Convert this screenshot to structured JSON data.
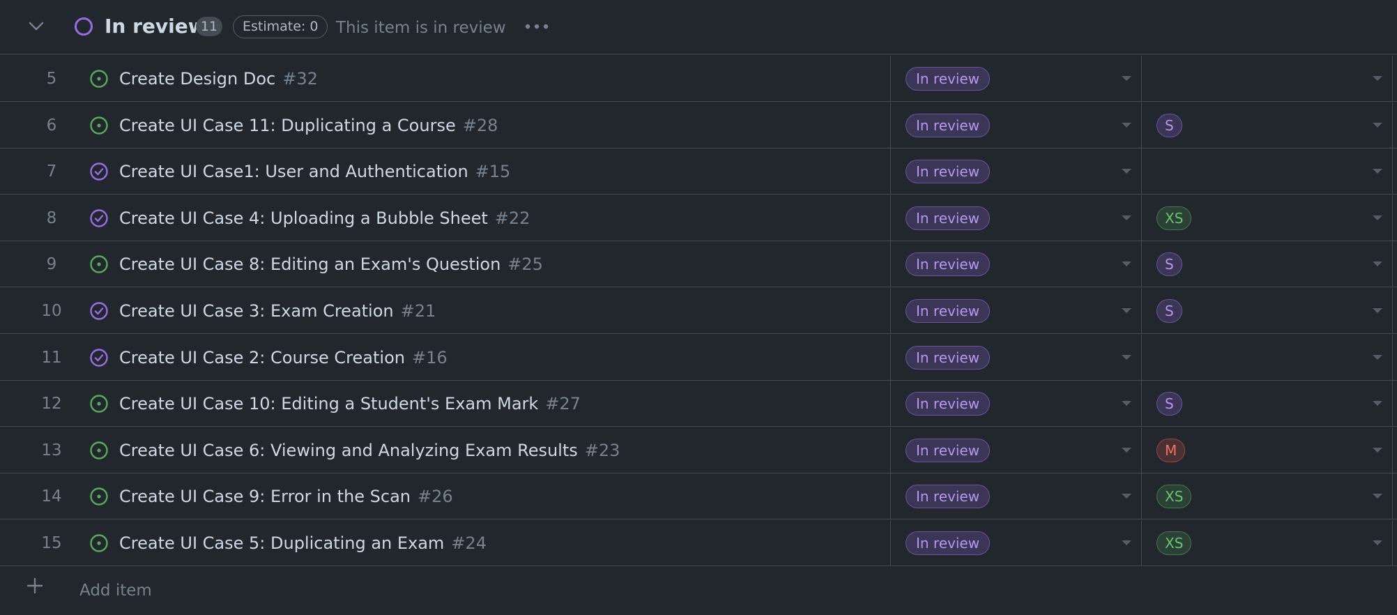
{
  "group": {
    "title": "In review",
    "count": "11",
    "estimate": "Estimate: 0",
    "description": "This item is in review",
    "status_color": "#986ee2"
  },
  "rows": [
    {
      "num": "5",
      "title": "Create Design Doc",
      "issue": "#32",
      "icon": "issue-open-icon",
      "status": "In review",
      "size": ""
    },
    {
      "num": "6",
      "title": "Create UI Case 11: Duplicating a Course",
      "issue": "#28",
      "icon": "issue-open-icon",
      "status": "In review",
      "size": "S"
    },
    {
      "num": "7",
      "title": "Create UI Case1: User and Authentication",
      "issue": "#15",
      "icon": "issue-closed-icon",
      "status": "In review",
      "size": ""
    },
    {
      "num": "8",
      "title": "Create UI Case 4: Uploading a Bubble Sheet",
      "issue": "#22",
      "icon": "issue-closed-icon",
      "status": "In review",
      "size": "XS"
    },
    {
      "num": "9",
      "title": "Create UI Case 8: Editing an Exam's Question",
      "issue": "#25",
      "icon": "issue-open-icon",
      "status": "In review",
      "size": "S"
    },
    {
      "num": "10",
      "title": "Create UI Case 3: Exam Creation",
      "issue": "#21",
      "icon": "issue-closed-icon",
      "status": "In review",
      "size": "S"
    },
    {
      "num": "11",
      "title": "Create UI Case 2: Course Creation",
      "issue": "#16",
      "icon": "issue-closed-icon",
      "status": "In review",
      "size": ""
    },
    {
      "num": "12",
      "title": "Create UI Case 10: Editing a Student's Exam Mark",
      "issue": "#27",
      "icon": "issue-open-icon",
      "status": "In review",
      "size": "S"
    },
    {
      "num": "13",
      "title": "Create UI Case 6: Viewing and Analyzing Exam Results",
      "issue": "#23",
      "icon": "issue-open-icon",
      "status": "In review",
      "size": "M"
    },
    {
      "num": "14",
      "title": "Create UI Case 9: Error in the Scan",
      "issue": "#26",
      "icon": "issue-open-icon",
      "status": "In review",
      "size": "XS"
    },
    {
      "num": "15",
      "title": "Create UI Case 5: Duplicating an Exam",
      "issue": "#24",
      "icon": "issue-open-icon",
      "status": "In review",
      "size": "XS"
    }
  ],
  "add_item": {
    "label": "Add item"
  },
  "colors": {
    "background": "#22272e",
    "open_icon": "#57ab5a",
    "closed_icon": "#986ee2",
    "status_pill": "#b897f2"
  }
}
